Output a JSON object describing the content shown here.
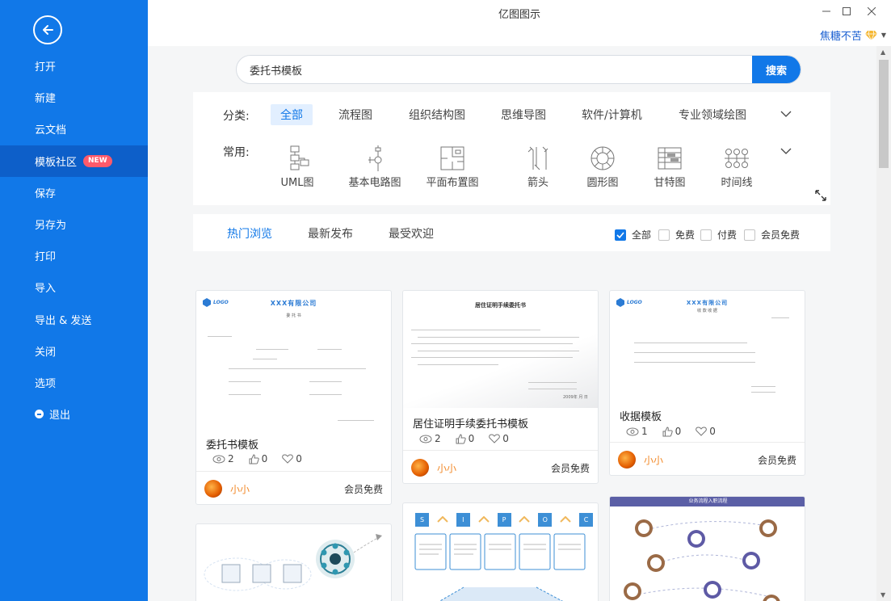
{
  "app": {
    "title": "亿图图示"
  },
  "window": {
    "minimize_icon": "minimize-icon",
    "maximize_icon": "maximize-icon",
    "close_icon": "close-icon"
  },
  "user": {
    "name": "焦糖不苦",
    "vip_icon": "diamond-icon"
  },
  "sidebar": {
    "back_icon": "arrow-left-icon",
    "items": [
      {
        "label": "打开"
      },
      {
        "label": "新建"
      },
      {
        "label": "云文档"
      },
      {
        "label": "模板社区",
        "badge": "NEW",
        "active": true
      },
      {
        "label": "保存"
      },
      {
        "label": "另存为"
      },
      {
        "label": "打印"
      },
      {
        "label": "导入"
      },
      {
        "label": "导出 & 发送"
      },
      {
        "label": "关闭"
      },
      {
        "label": "选项"
      },
      {
        "label": "退出",
        "icon": "exit-icon"
      }
    ]
  },
  "search": {
    "value": "委托书模板",
    "button": "搜索"
  },
  "filters": {
    "category_label": "分类:",
    "categories": [
      "全部",
      "流程图",
      "组织结构图",
      "思维导图",
      "软件/计算机",
      "专业领域绘图"
    ],
    "common_label": "常用:",
    "common": [
      "UML图",
      "基本电路图",
      "平面布置图",
      "箭头",
      "圆形图",
      "甘特图",
      "时间线"
    ]
  },
  "tabs": [
    "热门浏览",
    "最新发布",
    "最受欢迎"
  ],
  "price_filters": [
    {
      "label": "全部",
      "checked": true
    },
    {
      "label": "免费",
      "checked": false
    },
    {
      "label": "付费",
      "checked": false
    },
    {
      "label": "会员免费",
      "checked": false
    }
  ],
  "cards": [
    {
      "title": "委托书模板",
      "views": "2",
      "likes": "0",
      "favorites": "0",
      "author": "小小",
      "price": "会员免费",
      "thumb": {
        "logo": "LOGO",
        "company": "XXX有限公司",
        "doc_title": "委 托 书"
      }
    },
    {
      "title": "居住证明手续委托书模板",
      "views": "2",
      "likes": "0",
      "favorites": "0",
      "author": "小小",
      "price": "会员免费",
      "thumb": {
        "doc_title": "居住证明手续委托书",
        "date_text": "2009年 月 日"
      }
    },
    {
      "title": "收据模板",
      "views": "1",
      "likes": "0",
      "favorites": "0",
      "author": "小小",
      "price": "会员免费",
      "thumb": {
        "logo": "LOGO",
        "company": "XXX有限公司",
        "doc_title": "收 款 收 据"
      }
    }
  ],
  "bottom_cards": [
    {
      "type": "mindmap-diagram"
    },
    {
      "letters": [
        "S",
        "I",
        "P",
        "O",
        "C"
      ]
    },
    {
      "banner": "业务流程入职流程"
    }
  ],
  "colors": {
    "accent": "#1178e8",
    "sidebar": "#1178e8",
    "author": "#f28a2a",
    "badge": "#ff5a6a"
  }
}
